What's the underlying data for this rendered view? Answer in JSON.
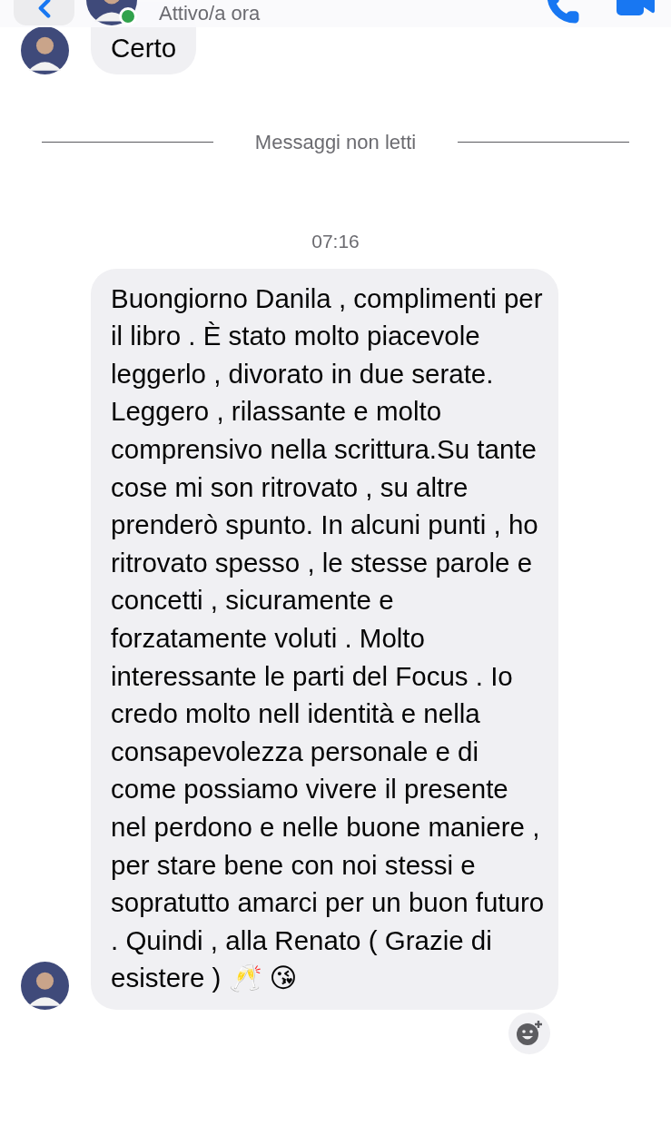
{
  "header": {
    "status": "Attivo/a ora",
    "online": true
  },
  "earlier_message": {
    "text": "Certo"
  },
  "unread_divider": {
    "label": "Messaggi non letti"
  },
  "timestamp": "07:16",
  "message": {
    "text": "Buongiorno Danila , complimenti per il libro . È stato molto piacevole leggerlo , divorato in due serate. Leggero , rilassante e molto comprensivo nella scrittura.Su tante cose mi son ritrovato , su altre prenderò spunto. In alcuni punti , ho ritrovato spesso , le stesse parole e concetti , sicuramente e forzatamente voluti . Molto interessante le parti del Focus . Io credo molto nell identità e nella consapevolezza personale e di come possiamo vivere il presente nel perdono e nelle buone maniere , per stare bene con noi stessi e sopratutto amarci per un buon futuro . Quindi , alla Renato ( Grazie di esistere ) 🥂 😘"
  }
}
